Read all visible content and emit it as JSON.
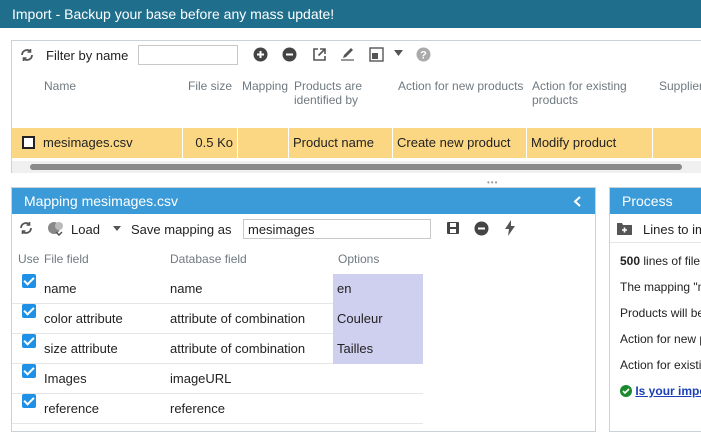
{
  "title": "Import - Backup your base before any mass update!",
  "top_toolbar": {
    "filter_label": "Filter by name",
    "filter_value": "",
    "filter_placeholder": ""
  },
  "file_grid": {
    "columns": [
      "Name",
      "File size",
      "Mapping",
      "Products are identified by",
      "Action for new products",
      "Action for existing products",
      "Supplier"
    ],
    "rows": [
      {
        "name": "mesimages.csv",
        "size": "0.5 Ko",
        "mapping": "",
        "identified_by": "Product name",
        "action_new": "Create new product",
        "action_existing": "Modify product",
        "selected": true
      }
    ]
  },
  "mapping_panel": {
    "title": "Mapping mesimages.csv",
    "load_label": "Load",
    "save_label": "Save mapping as",
    "save_value": "mesimages",
    "columns": [
      "Use",
      "File field",
      "Database field",
      "Options"
    ],
    "rows": [
      {
        "file_field": "name",
        "db_field": "name",
        "option": "en",
        "checked": true
      },
      {
        "file_field": "color attribute",
        "db_field": "attribute of combination",
        "option": "Couleur",
        "checked": true
      },
      {
        "file_field": "size attribute",
        "db_field": "attribute of combination",
        "option": "Tailles",
        "checked": true
      },
      {
        "file_field": "Images",
        "db_field": "imageURL",
        "option": "",
        "checked": true
      },
      {
        "file_field": "reference",
        "db_field": "reference",
        "option": "",
        "checked": true
      }
    ]
  },
  "process_panel": {
    "title": "Process",
    "tool_label": "Lines to im",
    "lines": [
      "lines of file",
      "The mapping \"m",
      "Products will be",
      "Action for new p",
      "Action for existi"
    ],
    "count": "500",
    "link": "Is your impo"
  },
  "colors": {
    "titlebar": "#1f6e8c",
    "panel_header": "#3b9bd8",
    "selected_row": "#fbd783",
    "options_bg": "#cfcff0",
    "checkbox": "#1e90e6"
  }
}
